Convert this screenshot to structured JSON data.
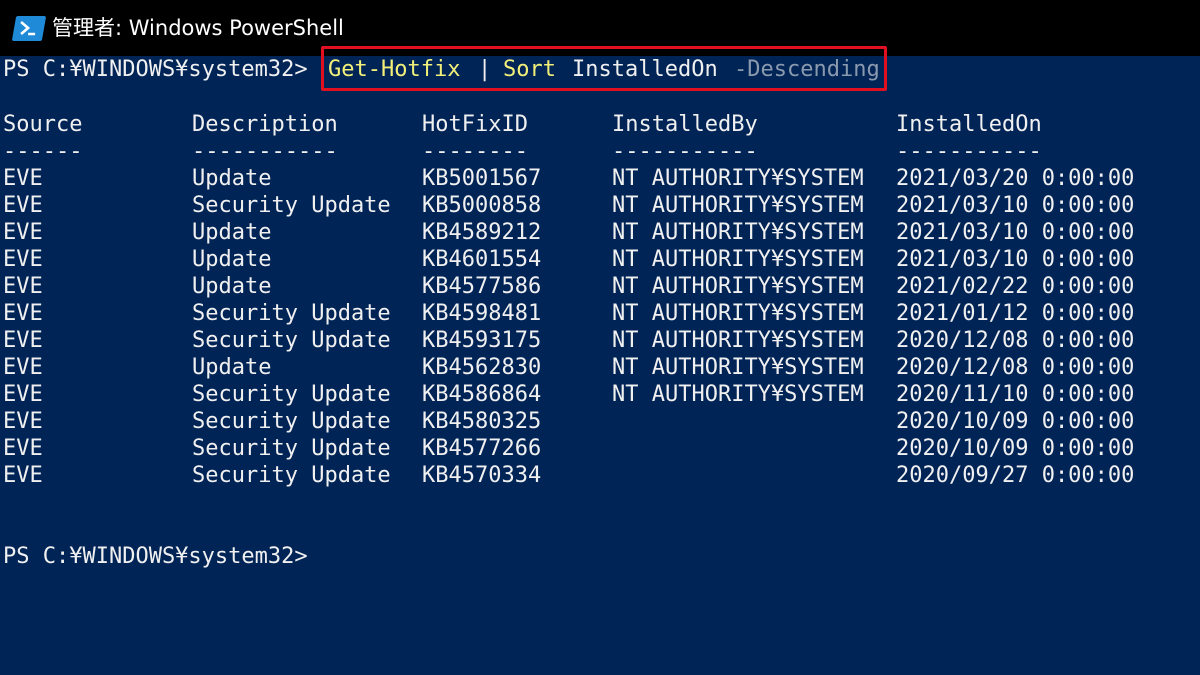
{
  "window": {
    "title": "管理者: Windows PowerShell",
    "background_color": "#012456",
    "titlebar_color": "#000000",
    "icon": "powershell-icon"
  },
  "command_line": {
    "prompt": "PS C:¥WINDOWS¥system32>",
    "tokens": [
      {
        "text": "Get-Hotfix",
        "color": "#f3f07a"
      },
      {
        "text": "|",
        "color": "#f0f0f0"
      },
      {
        "text": "Sort",
        "color": "#f3f07a"
      },
      {
        "text": "InstalledOn",
        "color": "#f0f0f0"
      },
      {
        "text": "-Descending",
        "color": "#8a9aae"
      }
    ],
    "highlight_color": "#e01020"
  },
  "table": {
    "headers": [
      "Source",
      "Description",
      "HotFixID",
      "InstalledBy",
      "InstalledOn"
    ],
    "underlines": [
      "------",
      "-----------",
      "--------",
      "-----------",
      "-----------"
    ],
    "rows": [
      [
        "EVE",
        "Update",
        "KB5001567",
        "NT AUTHORITY¥SYSTEM",
        "2021/03/20 0:00:00"
      ],
      [
        "EVE",
        "Security Update",
        "KB5000858",
        "NT AUTHORITY¥SYSTEM",
        "2021/03/10 0:00:00"
      ],
      [
        "EVE",
        "Update",
        "KB4589212",
        "NT AUTHORITY¥SYSTEM",
        "2021/03/10 0:00:00"
      ],
      [
        "EVE",
        "Update",
        "KB4601554",
        "NT AUTHORITY¥SYSTEM",
        "2021/03/10 0:00:00"
      ],
      [
        "EVE",
        "Update",
        "KB4577586",
        "NT AUTHORITY¥SYSTEM",
        "2021/02/22 0:00:00"
      ],
      [
        "EVE",
        "Security Update",
        "KB4598481",
        "NT AUTHORITY¥SYSTEM",
        "2021/01/12 0:00:00"
      ],
      [
        "EVE",
        "Security Update",
        "KB4593175",
        "NT AUTHORITY¥SYSTEM",
        "2020/12/08 0:00:00"
      ],
      [
        "EVE",
        "Update",
        "KB4562830",
        "NT AUTHORITY¥SYSTEM",
        "2020/12/08 0:00:00"
      ],
      [
        "EVE",
        "Security Update",
        "KB4586864",
        "NT AUTHORITY¥SYSTEM",
        "2020/11/10 0:00:00"
      ],
      [
        "EVE",
        "Security Update",
        "KB4580325",
        "",
        "2020/10/09 0:00:00"
      ],
      [
        "EVE",
        "Security Update",
        "KB4577266",
        "",
        "2020/10/09 0:00:00"
      ],
      [
        "EVE",
        "Security Update",
        "KB4570334",
        "",
        "2020/09/27 0:00:00"
      ]
    ]
  },
  "final_prompt": "PS C:¥WINDOWS¥system32>"
}
